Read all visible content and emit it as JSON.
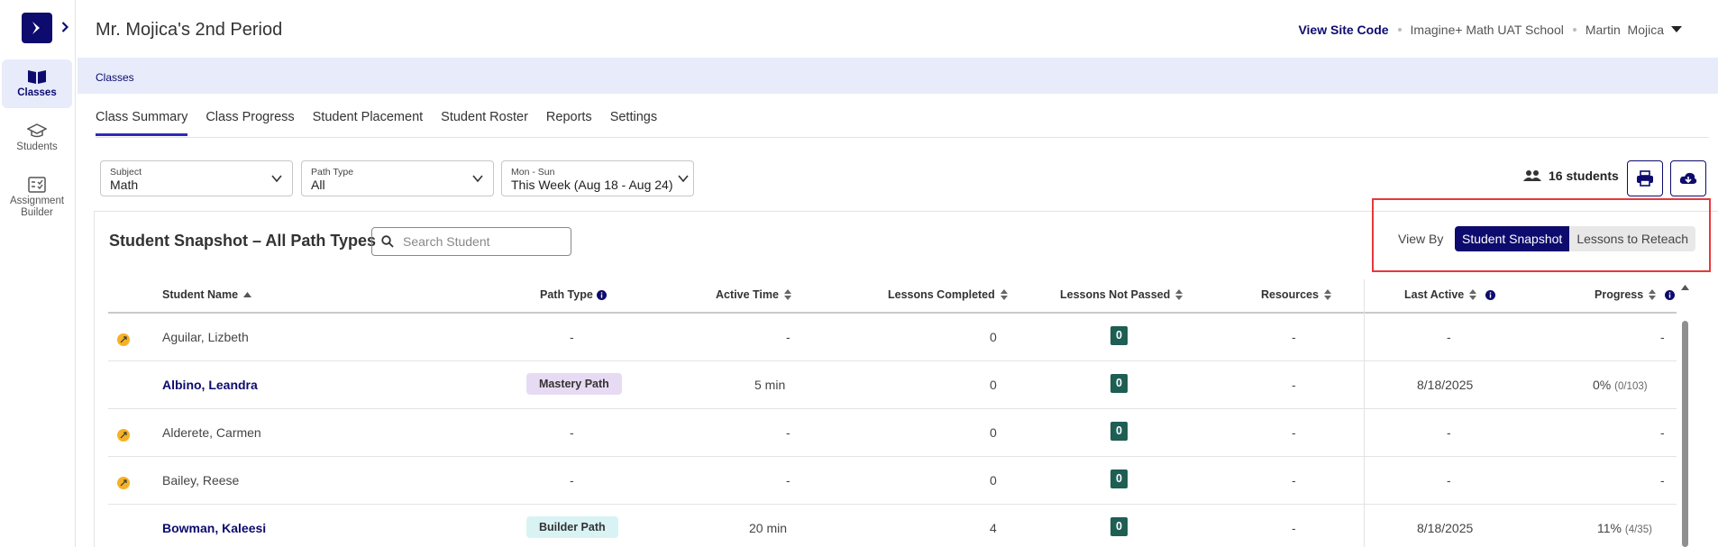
{
  "sidebar": {
    "items": [
      {
        "label": "Classes",
        "icon": "book-icon"
      },
      {
        "label": "Students",
        "icon": "graduation-cap-icon"
      },
      {
        "label": "Assignment Builder",
        "icon": "checklist-icon"
      }
    ]
  },
  "header": {
    "title": "Mr. Mojica's 2nd Period",
    "site_code": "View Site Code",
    "school": "Imagine+ Math UAT School",
    "user_first": "Martin",
    "user_last": "Mojica"
  },
  "breadcrumb": "Classes",
  "tabs": [
    "Class Summary",
    "Class Progress",
    "Student Placement",
    "Student Roster",
    "Reports",
    "Settings"
  ],
  "filters": {
    "subject": {
      "label": "Subject",
      "value": "Math"
    },
    "path_type": {
      "label": "Path Type",
      "value": "All"
    },
    "date": {
      "label": "Mon - Sun",
      "value": "This Week (Aug 18 - Aug 24)"
    }
  },
  "students_count": "16 students",
  "snapshot": {
    "title": "Student Snapshot – All Path Types",
    "search_placeholder": "Search Student",
    "view_by_label": "View By",
    "view_options": [
      "Student Snapshot",
      "Lessons to Reteach"
    ]
  },
  "table": {
    "columns": [
      "Student Name",
      "Path Type",
      "Active Time",
      "Lessons Completed",
      "Lessons Not Passed",
      "Resources",
      "Last Active",
      "Progress"
    ],
    "rows": [
      {
        "name": "Aguilar, Lizbeth",
        "path": "-",
        "time": "-",
        "completed": "0",
        "not_passed": "0",
        "resources": "-",
        "last_active": "-",
        "progress": "-",
        "progress_detail": ""
      },
      {
        "name": "Albino, Leandra",
        "path": "Mastery Path",
        "time": "5 min",
        "completed": "0",
        "not_passed": "0",
        "resources": "-",
        "last_active": "8/18/2025",
        "progress": "0%",
        "progress_detail": "(0/103)"
      },
      {
        "name": "Alderete, Carmen",
        "path": "-",
        "time": "-",
        "completed": "0",
        "not_passed": "0",
        "resources": "-",
        "last_active": "-",
        "progress": "-",
        "progress_detail": ""
      },
      {
        "name": "Bailey, Reese",
        "path": "-",
        "time": "-",
        "completed": "0",
        "not_passed": "0",
        "resources": "-",
        "last_active": "-",
        "progress": "-",
        "progress_detail": ""
      },
      {
        "name": "Bowman, Kaleesi",
        "path": "Builder Path",
        "time": "20 min",
        "completed": "4",
        "not_passed": "0",
        "resources": "-",
        "last_active": "8/18/2025",
        "progress": "11%",
        "progress_detail": "(4/35)"
      }
    ]
  },
  "colors": {
    "brand": "#0d0b6e",
    "highlight": "#e8383d",
    "pass_badge": "#1e5e53"
  }
}
